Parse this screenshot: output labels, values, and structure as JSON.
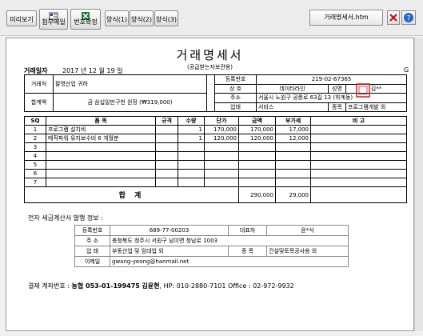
{
  "toolbar": {
    "preview": "미리보기",
    "attach": "첨부메일",
    "attach_icon_text": "S",
    "confirm": "번호확정",
    "confirm_icon_text": "X",
    "form1": "양식(1)",
    "form2": "양식(2)",
    "form3": "양식(3)",
    "filename": "거래명세서.htm",
    "close_icon": "close-icon",
    "help_icon": "help-icon"
  },
  "doc": {
    "title": "거래명세서",
    "subtitle": "(공급받는자보관용)",
    "date_label": "거래일자",
    "date_value": "2017 년 12 월 19 일",
    "g_mark": "G",
    "buyer_label": "거래처",
    "buyer_value": "팔영산업 귀하",
    "total_label": "합계액",
    "total_value": "금 삼십일만구천 원정 (₩319,000)",
    "supplier": {
      "regno_label": "등록번호",
      "regno_value": "219-02-67365",
      "company_label": "상 호",
      "company_value": "데이타라인",
      "name_label": "성명",
      "name_value": "김**",
      "addr_label": "주소",
      "addr_value": "서울시 노원구 공릉로 63길 13 (하계동)",
      "type_label": "업태",
      "type_value": "서비스",
      "item_label": "종목",
      "item_value": "프로그램개발 외"
    }
  },
  "items": {
    "headers": [
      "SQ",
      "품 목",
      "규격",
      "수량",
      "단가",
      "금액",
      "부가세",
      "비 고"
    ],
    "rows": [
      [
        "1",
        "프로그램 설치비",
        "",
        "1",
        "170,000",
        "170,000",
        "17,000",
        ""
      ],
      [
        "2",
        "메직파워 유지보수비 6 개월분",
        "",
        "1",
        "120,000",
        "120,000",
        "12,000",
        ""
      ],
      [
        "3",
        "",
        "",
        "",
        "",
        "",
        "",
        ""
      ],
      [
        "4",
        "",
        "",
        "",
        "",
        "",
        "",
        ""
      ],
      [
        "5",
        "",
        "",
        "",
        "",
        "",
        "",
        ""
      ],
      [
        "6",
        "",
        "",
        "",
        "",
        "",
        "",
        ""
      ],
      [
        "7",
        "",
        "",
        "",
        "",
        "",
        "",
        ""
      ]
    ],
    "sum_label": "합 계",
    "sum_amount": "290,000",
    "sum_vat": "29,000"
  },
  "etax": {
    "heading": "전자 세금계산서 발행 정보 :",
    "regno_label": "등록번호",
    "regno_value": "689-77-00203",
    "rep_label": "대표자",
    "rep_value": "윤*식",
    "addr_label": "주 소",
    "addr_value": "충청북도 청주시 서원구 남이면 청남로 1003",
    "type_label": "업 태",
    "type_value": "부동산업 및 임대업 외",
    "item_label": "종 목",
    "item_value": "건설및토목공사용 외",
    "email_label": "이메일",
    "email_value": "gwang-yeong@hanmail.net"
  },
  "payment": {
    "label": "결제 계좌번호 :",
    "bank": "농협 053-01-199475",
    "holder": "김윤현",
    "phone": ", HP: 010-2880-7101 Office : 02-972-9932"
  },
  "colors": {
    "paper": "#ffffff",
    "frame": "#f0f0f0"
  }
}
